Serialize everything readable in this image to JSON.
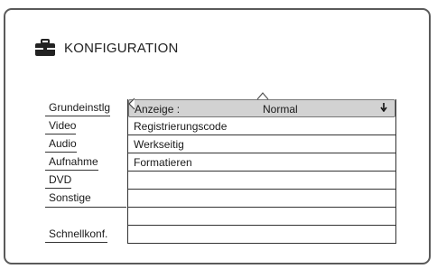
{
  "header": {
    "title": "KONFIGURATION",
    "icon": "toolbox-icon"
  },
  "menu": {
    "items": [
      {
        "label": "Grundeinstlg"
      },
      {
        "label": "Video"
      },
      {
        "label": "Audio"
      },
      {
        "label": "Aufnahme"
      },
      {
        "label": "DVD"
      },
      {
        "label": "Sonstige"
      },
      {
        "label": ""
      },
      {
        "label": "Schnellkonf."
      }
    ]
  },
  "panel": {
    "selected": {
      "label": "Anzeige :",
      "value": "Normal",
      "arrow_icon": "arrow-down-icon"
    },
    "rows": [
      {
        "label": "Registrierungscode"
      },
      {
        "label": "Werkseitig"
      },
      {
        "label": "Formatieren"
      }
    ]
  }
}
